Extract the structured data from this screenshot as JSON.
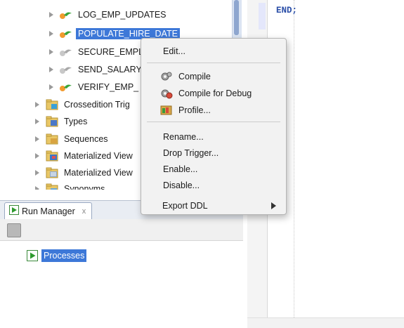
{
  "tree": {
    "items": [
      {
        "label": "LOG_EMP_UPDATES"
      },
      {
        "label": "POPULATE_HIRE_DATE"
      },
      {
        "label": "SECURE_EMPL"
      },
      {
        "label": "SEND_SALARY"
      },
      {
        "label": "VERIFY_EMP_"
      },
      {
        "label": "Crossedition Trig"
      },
      {
        "label": "Types"
      },
      {
        "label": "Sequences"
      },
      {
        "label": "Materialized View"
      },
      {
        "label": "Materialized View"
      },
      {
        "label": "Synonyms"
      }
    ]
  },
  "editor": {
    "code_line": "END;"
  },
  "context_menu": {
    "items": {
      "edit": "Edit...",
      "compile": "Compile",
      "compile_debug": "Compile for Debug",
      "profile": "Profile...",
      "rename": "Rename...",
      "drop_trigger": "Drop Trigger...",
      "enable": "Enable...",
      "disable": "Disable...",
      "export_ddl": "Export DDL"
    }
  },
  "run_manager": {
    "tab_label": "Run Manager",
    "tab_close": "x",
    "processes_label": "Processes"
  }
}
